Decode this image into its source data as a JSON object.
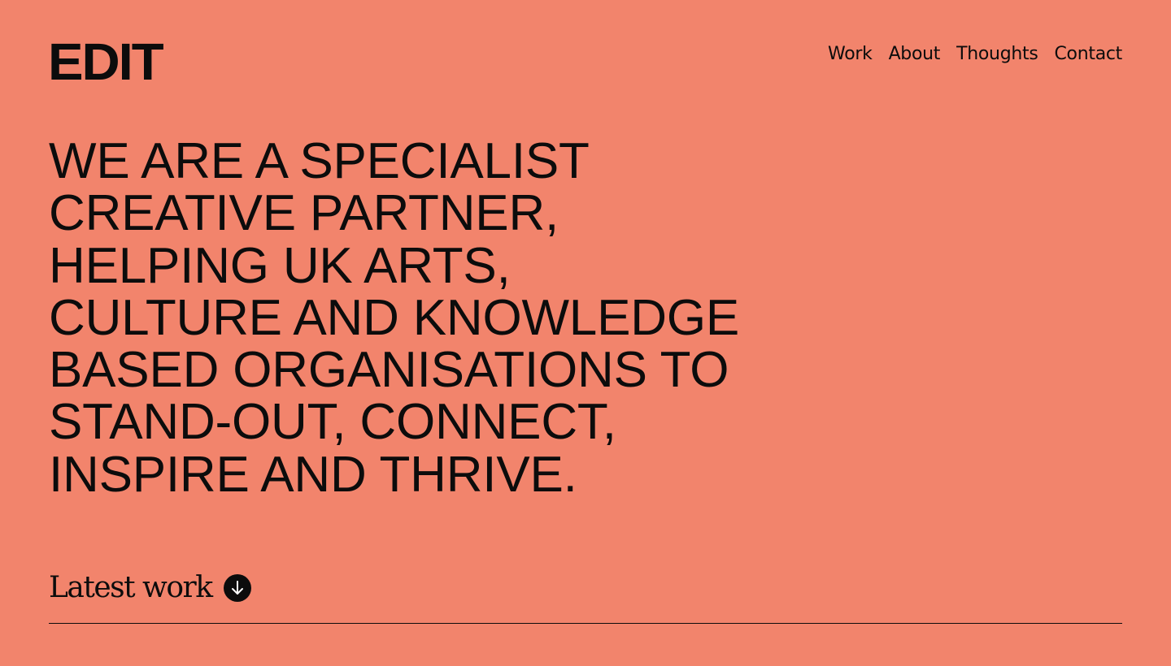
{
  "header": {
    "logo": "EDIT",
    "nav": [
      {
        "label": "Work"
      },
      {
        "label": "About"
      },
      {
        "label": "Thoughts"
      },
      {
        "label": "Contact"
      }
    ]
  },
  "hero": {
    "lines": [
      "WE ARE A SPECIALIST",
      "CREATIVE PARTNER,",
      "HELPING UK ARTS,",
      "CULTURE AND KNOWLEDGE",
      "BASED ORGANISATIONS TO",
      "STAND-OUT, CONNECT,",
      "INSPIRE AND THRIVE."
    ]
  },
  "latest_work": {
    "label": "Latest work",
    "icon": "arrow-down-icon"
  },
  "colors": {
    "background": "#f2846c",
    "text": "#0c0c0c"
  }
}
